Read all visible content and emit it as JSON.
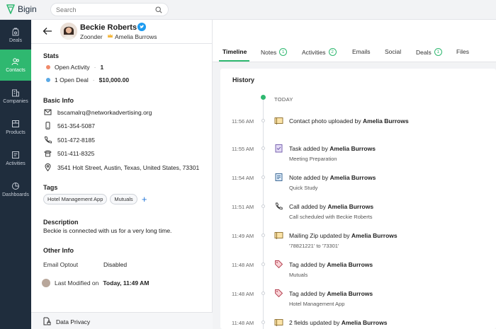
{
  "app": {
    "name": "Bigin"
  },
  "search": {
    "placeholder": "Search"
  },
  "nav": [
    {
      "label": "Deals",
      "icon": "deals-icon"
    },
    {
      "label": "Contacts",
      "icon": "contacts-icon",
      "active": true
    },
    {
      "label": "Companies",
      "icon": "companies-icon"
    },
    {
      "label": "Products",
      "icon": "products-icon"
    },
    {
      "label": "Activities",
      "icon": "activities-icon"
    },
    {
      "label": "Dashboards",
      "icon": "dashboards-icon"
    }
  ],
  "contact": {
    "name": "Beckie Roberts",
    "company": "Zoonder",
    "owner": "Amelia Burrows"
  },
  "stats": {
    "title": "Stats",
    "open_activity_label": "Open Activity",
    "open_activity_count": "1",
    "open_deal_label": "1 Open Deal",
    "open_deal_value": "$10,000.00",
    "activity_color": "#f08a6a",
    "deal_color": "#5aa9e6"
  },
  "basic_info": {
    "title": "Basic Info",
    "email": "bscamalrq@networkadvertising.org",
    "mobile": "561-354-5087",
    "phone": "501-472-8185",
    "home_phone": "501-411-8325",
    "address": "3541 Holt Street, Austin, Texas, United States, 73301"
  },
  "tags": {
    "title": "Tags",
    "items": [
      "Hotel Management App",
      "Mutuals"
    ],
    "add_symbol": "+"
  },
  "description": {
    "title": "Description",
    "text": "Beckie is connected with us for a very long time."
  },
  "other_info": {
    "title": "Other Info",
    "email_optout_label": "Email Optout",
    "email_optout_value": "Disabled",
    "last_modified_prefix": "Last Modified on",
    "last_modified_value": "Today, 11:49 AM"
  },
  "data_privacy": {
    "label": "Data Privacy"
  },
  "tabs": [
    {
      "label": "Timeline",
      "active": true
    },
    {
      "label": "Notes",
      "count": "1"
    },
    {
      "label": "Activities",
      "count": "2"
    },
    {
      "label": "Emails"
    },
    {
      "label": "Social"
    },
    {
      "label": "Deals",
      "count": "1"
    },
    {
      "label": "Files"
    }
  ],
  "history": {
    "title": "History",
    "today_label": "TODAY",
    "events": [
      {
        "time": "11:56 AM",
        "icon": "photo-icon",
        "title": "Contact photo uploaded by",
        "actor": "Amelia Burrows",
        "sub": ""
      },
      {
        "time": "11:55 AM",
        "icon": "task-icon",
        "title": "Task added by",
        "actor": "Amelia Burrows",
        "sub": "Meeting Preparation"
      },
      {
        "time": "11:54 AM",
        "icon": "note-icon",
        "title": "Note added by",
        "actor": "Amelia Burrows",
        "sub": "Quick Study"
      },
      {
        "time": "11:51 AM",
        "icon": "call-icon",
        "title": "Call added by",
        "actor": "Amelia Burrows",
        "sub": "Call scheduled with Beckie Roberts"
      },
      {
        "time": "11:49 AM",
        "icon": "field-update-icon",
        "title": "Mailing Zip updated by",
        "actor": "Amelia Burrows",
        "sub": "'78821221' to '73301'"
      },
      {
        "time": "11:48 AM",
        "icon": "tag-icon",
        "title": "Tag added by",
        "actor": "Amelia Burrows",
        "sub": "Mutuals"
      },
      {
        "time": "11:48 AM",
        "icon": "tag-icon",
        "title": "Tag added by",
        "actor": "Amelia Burrows",
        "sub": "Hotel Management App"
      },
      {
        "time": "11:48 AM",
        "icon": "field-update-icon",
        "title": "2 fields updated by",
        "actor": "Amelia Burrows",
        "sub": ""
      }
    ]
  },
  "colors": {
    "accent": "#2fb870",
    "sidebar": "#1f2d3d",
    "link_blue": "#2477d8"
  }
}
